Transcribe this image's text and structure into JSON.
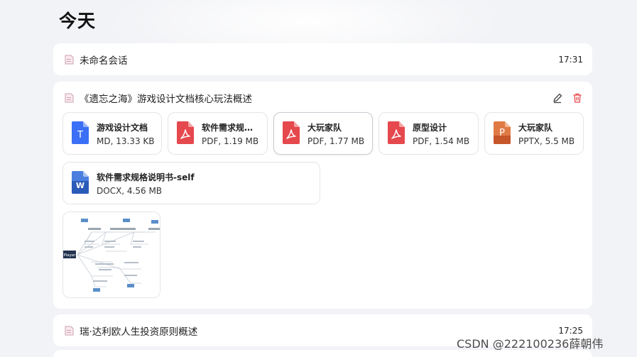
{
  "section": {
    "title": "今天"
  },
  "conversations": [
    {
      "title": "未命名会话",
      "time": "17:31",
      "icon": "document-icon"
    },
    {
      "title": "《遗忘之海》游戏设计文档核心玩法概述",
      "icon": "document-icon",
      "actions": [
        {
          "name": "edit-icon",
          "color": "#444444"
        },
        {
          "name": "delete-icon",
          "color": "#e5484d"
        }
      ],
      "files": [
        {
          "name": "游戏设计文档",
          "meta": "MD, 13.33 KB",
          "icon": "markdown-file-icon",
          "color": "#3b6ff5",
          "letter": "T"
        },
        {
          "name": "软件需求规格说明书",
          "meta": "PDF, 1.19 MB",
          "icon": "pdf-file-icon",
          "color": "#e5484d"
        },
        {
          "name": "大玩家队",
          "meta": "PDF, 1.77 MB",
          "icon": "pdf-file-icon",
          "color": "#e5484d"
        },
        {
          "name": "原型设计",
          "meta": "PDF, 1.54 MB",
          "icon": "pdf-file-icon",
          "color": "#e5484d"
        },
        {
          "name": "大玩家队",
          "meta": "PPTX, 5.5 MB",
          "icon": "pptx-file-icon",
          "color": "#e07a45",
          "letter": "P"
        },
        {
          "name": "软件需求规格说明书-self",
          "meta": "DOCX, 4.56 MB",
          "icon": "docx-file-icon",
          "color": "#2b5bb8",
          "letter": "W"
        }
      ],
      "image_attachment": {
        "name": "mind-map-image-thumbnail",
        "center_label": "Player"
      }
    },
    {
      "title": "瑞·达利欧人生投资原则概述",
      "time": "17:25",
      "icon": "document-icon"
    }
  ],
  "watermark": "CSDN @222100236薛朝伟"
}
